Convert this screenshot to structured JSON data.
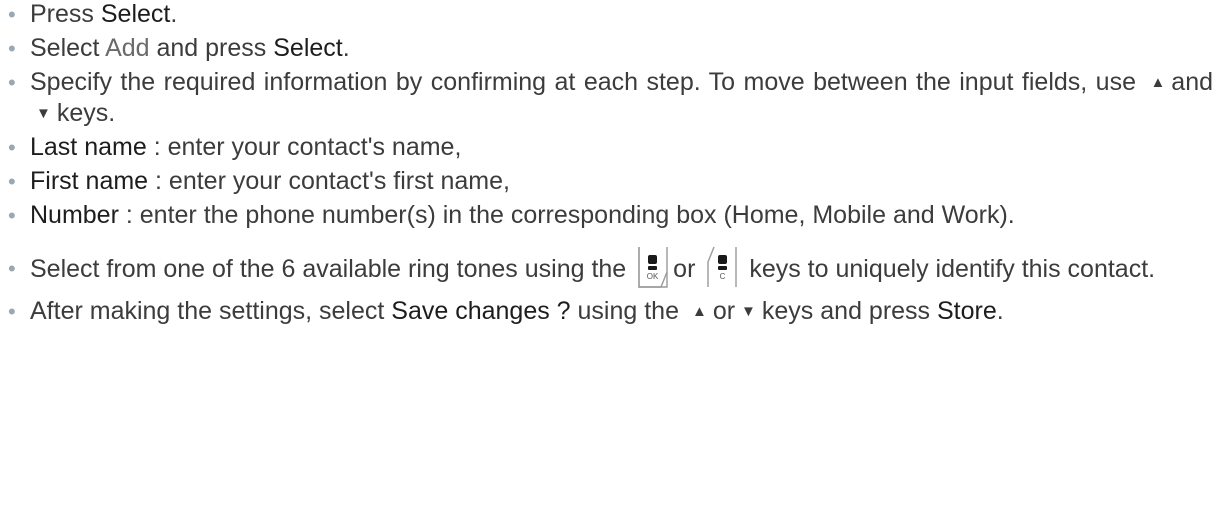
{
  "items": {
    "i1": {
      "pre": "Press ",
      "kw": "Select",
      "post": "."
    },
    "i2": {
      "pre": "Select ",
      "hl": "Add",
      "mid": " and press ",
      "kw": "Select",
      "post": "."
    },
    "i3": {
      "text1": "Specify the required information by confirming at each step. To move between the input fields, use",
      "and": "and",
      "post": "keys."
    },
    "i4": {
      "kw": "Last name",
      "post": " : enter your contact's name,"
    },
    "i5": {
      "kw": "First name",
      "post": " : enter your contact's first name,"
    },
    "i6": {
      "kw": "Number",
      "post": " : enter the phone number(s) in the corresponding box (Home, Mobile and Work)."
    },
    "i7": {
      "pre": "Select from one of the 6 available ring tones using the",
      "or": "or",
      "post": "keys to uniquely identify this contact."
    },
    "i8": {
      "pre": "After making the settings, select ",
      "kw": "Save changes ?",
      "mid": " using the",
      "or": "or",
      "mid2": "keys and press ",
      "kw2": "Store",
      "post": "."
    }
  },
  "keys": {
    "ok_label": "OK",
    "c_label": "C"
  },
  "bullet_char": "•",
  "icons": {
    "up": "up-arrow-icon",
    "down": "down-arrow-icon",
    "ok_key": "ok-key-icon",
    "c_key": "c-key-icon"
  }
}
